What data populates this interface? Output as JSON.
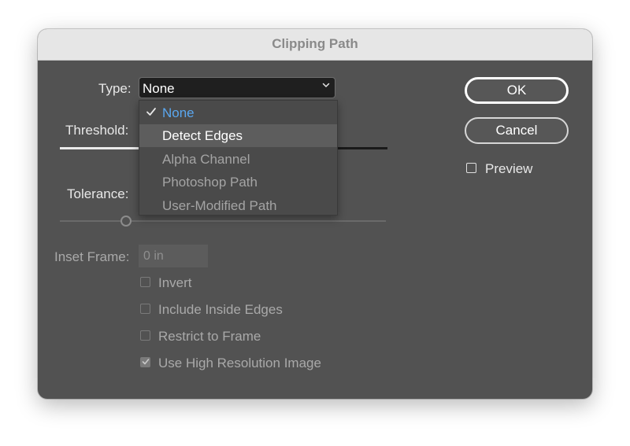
{
  "window": {
    "title": "Clipping Path"
  },
  "type_select": {
    "label": "Type:",
    "value": "None",
    "options": [
      {
        "label": "None",
        "checked": true,
        "enabled": true
      },
      {
        "label": "Detect Edges",
        "checked": false,
        "enabled": true,
        "highlighted": true
      },
      {
        "label": "Alpha Channel",
        "checked": false,
        "enabled": false
      },
      {
        "label": "Photoshop Path",
        "checked": false,
        "enabled": false
      },
      {
        "label": "User-Modified Path",
        "checked": false,
        "enabled": false
      }
    ]
  },
  "threshold": {
    "label": "Threshold:"
  },
  "tolerance": {
    "label": "Tolerance:"
  },
  "inset_frame": {
    "label": "Inset Frame:",
    "value": "0 in"
  },
  "options": {
    "invert": {
      "label": "Invert",
      "checked": false
    },
    "include_inside_edges": {
      "label": "Include Inside Edges",
      "checked": false
    },
    "restrict_to_frame": {
      "label": "Restrict to Frame",
      "checked": false
    },
    "use_high_resolution_image": {
      "label": "Use High Resolution Image",
      "checked": true
    }
  },
  "buttons": {
    "ok": "OK",
    "cancel": "Cancel"
  },
  "preview": {
    "label": "Preview",
    "checked": false
  },
  "colors": {
    "dialog_bg": "#525252",
    "titlebar_bg": "#e6e6e6",
    "menu_checked_text": "#5aa7ef",
    "menu_highlight": "#5d5d5d"
  }
}
